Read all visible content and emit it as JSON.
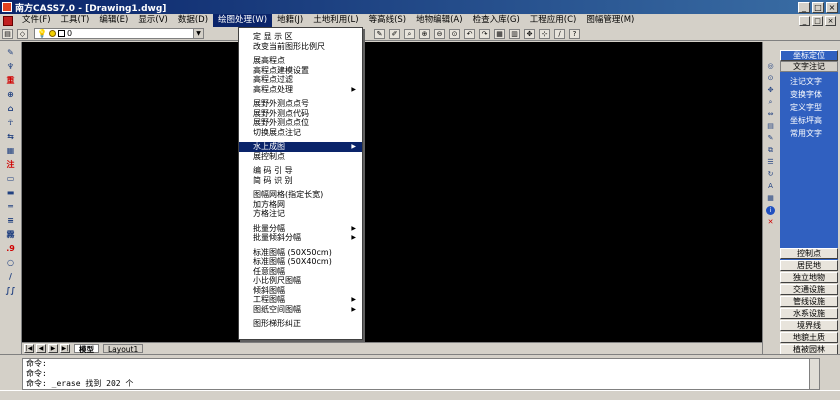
{
  "window": {
    "title": "南方CASS7.0 - [Drawing1.dwg]",
    "buttons": [
      "_",
      "□",
      "×"
    ]
  },
  "menubar": {
    "items": [
      {
        "label": "文件(F)"
      },
      {
        "label": "工具(T)"
      },
      {
        "label": "编辑(E)"
      },
      {
        "label": "显示(V)"
      },
      {
        "label": "数据(D)"
      },
      {
        "label": "绘图处理(W)",
        "active": true
      },
      {
        "label": "地籍(J)"
      },
      {
        "label": "土地利用(L)"
      },
      {
        "label": "等高线(S)"
      },
      {
        "label": "地物编辑(A)"
      },
      {
        "label": "检查入库(G)"
      },
      {
        "label": "工程应用(C)"
      },
      {
        "label": "图幅管理(M)"
      }
    ],
    "mdi_buttons": [
      "_",
      "□",
      "×"
    ]
  },
  "toolbar": {
    "layer_value": "0"
  },
  "left_toolbar": {
    "icons": [
      {
        "name": "draw-point-icon",
        "glyph": "✎"
      },
      {
        "name": "symbol-icon",
        "glyph": "♆"
      },
      {
        "name": "heavy-icon",
        "glyph": "重",
        "red": true
      },
      {
        "name": "node-icon",
        "glyph": "⊕"
      },
      {
        "name": "house-icon",
        "glyph": "⌂"
      },
      {
        "name": "tree-icon",
        "glyph": "☥"
      },
      {
        "name": "traverse-icon",
        "glyph": "⇆"
      },
      {
        "name": "grid-icon",
        "glyph": "▦"
      },
      {
        "name": "annotate-icon",
        "glyph": "注",
        "red": true
      },
      {
        "name": "rectangle-icon",
        "glyph": "▭"
      },
      {
        "name": "line-icon",
        "glyph": "▬"
      },
      {
        "name": "double-line-icon",
        "glyph": "═"
      },
      {
        "name": "road-icon",
        "glyph": "≡"
      },
      {
        "name": "elevation-icon",
        "glyph": "霧"
      },
      {
        "name": "height-point-icon",
        "glyph": ".9",
        "red": true
      },
      {
        "name": "circle-icon",
        "glyph": "○"
      },
      {
        "name": "polyline-icon",
        "glyph": "∕"
      },
      {
        "name": "contour-icon",
        "glyph": "∫∫"
      }
    ]
  },
  "canvas_tabs": {
    "model": "模型",
    "layout1": "Layout1"
  },
  "right_strip": {
    "icons": [
      {
        "name": "locate-icon",
        "glyph": "◎"
      },
      {
        "name": "zoom-icon",
        "glyph": "⊙"
      },
      {
        "name": "pan-icon",
        "glyph": "✥"
      },
      {
        "name": "search-icon",
        "glyph": "⌕"
      },
      {
        "name": "measure-icon",
        "glyph": "⇔"
      },
      {
        "name": "layer-icon",
        "glyph": "▤"
      },
      {
        "name": "edit-icon",
        "glyph": "✎"
      },
      {
        "name": "copy-icon",
        "glyph": "⧉"
      },
      {
        "name": "properties-icon",
        "glyph": "☰"
      },
      {
        "name": "refresh-icon",
        "glyph": "↻"
      },
      {
        "name": "text-icon",
        "glyph": "A"
      },
      {
        "name": "table-icon",
        "glyph": "▦"
      },
      {
        "name": "info-icon",
        "glyph": "i",
        "circle": true
      },
      {
        "name": "delete-icon",
        "glyph": "✕",
        "red": true
      }
    ]
  },
  "right_panel": {
    "top_button": "坐标定位",
    "second_button": "文字注记",
    "list_items": [
      "注记文字",
      "变换字体",
      "定义字型",
      "坐标坪高",
      "常用文字"
    ],
    "categories": [
      "控制点",
      "居民地",
      "独立地物",
      "交通设施",
      "管线设施",
      "水系设施",
      "境界线",
      "地貌土质",
      "植被园林"
    ]
  },
  "command": {
    "lines": [
      "命令:",
      "命令:",
      "命令: _erase 找到 202 个"
    ]
  },
  "dropdown": {
    "groups": [
      [
        {
          "label": "定 显 示 区"
        },
        {
          "label": "改变当前图形比例尺"
        }
      ],
      [
        {
          "label": "展高程点"
        },
        {
          "label": "高程点建模设置"
        },
        {
          "label": "高程点过滤"
        },
        {
          "label": "高程点处理",
          "submenu": true
        }
      ],
      [
        {
          "label": "展野外测点点号"
        },
        {
          "label": "展野外测点代码"
        },
        {
          "label": "展野外测点点位"
        },
        {
          "label": "切换展点注记"
        }
      ],
      [
        {
          "label": "水上成图",
          "submenu": true,
          "highlight": true
        },
        {
          "label": "展控制点"
        }
      ],
      [
        {
          "label": "编 码 引 导"
        },
        {
          "label": "简 码 识 别"
        }
      ],
      [
        {
          "label": "图幅网格(指定长宽)"
        },
        {
          "label": "加方格网"
        },
        {
          "label": "方格注记"
        }
      ],
      [
        {
          "label": "批量分幅",
          "submenu": true
        },
        {
          "label": "批量倾斜分幅",
          "submenu": true
        }
      ],
      [
        {
          "label": "标准图幅 (50X50cm)"
        },
        {
          "label": "标准图幅 (50X40cm)"
        },
        {
          "label": "任意图幅"
        },
        {
          "label": "小比例尺图幅"
        },
        {
          "label": "倾斜图幅"
        },
        {
          "label": "工程图幅",
          "submenu": true
        },
        {
          "label": "图纸空间图幅",
          "submenu": true
        }
      ],
      [
        {
          "label": "图形梯形纠正"
        }
      ]
    ]
  }
}
